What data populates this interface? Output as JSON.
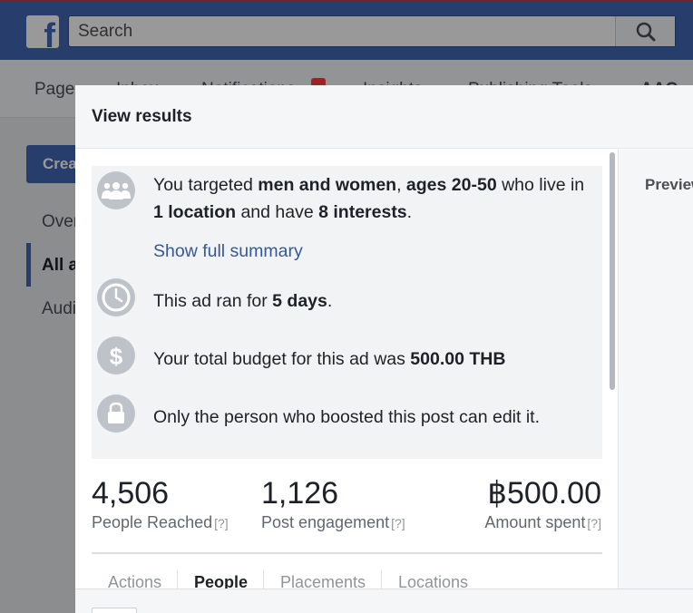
{
  "topbar": {
    "logo": "f",
    "search_placeholder": "Search",
    "search_icon": "search-icon"
  },
  "subnav": {
    "items": [
      "Page",
      "Inbox",
      "Notifications",
      "Insights",
      "Publishing Tools",
      "AAC"
    ]
  },
  "sidebar": {
    "create_label": "Create Ad",
    "links": [
      "Overview",
      "All ads",
      "Audiences"
    ]
  },
  "modal": {
    "title": "View results",
    "preview_label": "Preview",
    "summary": {
      "targeting_pre": "You targeted ",
      "gender": "men and women",
      "comma": ", ",
      "ages": "ages 20-50",
      "targeting_mid": " who live in ",
      "locations": "1 location",
      "targeting_and": " and have ",
      "interests": "8 interests",
      "targeting_end": ".",
      "show_full_summary": "Show full summary",
      "ran_pre": "This ad ran for ",
      "days": "5 days",
      "ran_end": ".",
      "budget_pre": "Your total budget for this ad was ",
      "budget": "500.00 THB",
      "edit_note": "Only the person who boosted this post can edit it."
    },
    "stats": [
      {
        "value": "4,506",
        "label": "People Reached",
        "help": "[?]"
      },
      {
        "value": "1,126",
        "label": "Post engagement",
        "help": "[?]"
      },
      {
        "value": "฿500.00",
        "label": "Amount spent",
        "help": "[?]"
      }
    ],
    "tabs": [
      "Actions",
      "People",
      "Placements",
      "Locations"
    ],
    "active_tab": "People"
  },
  "colors": {
    "brand": "#4267b2",
    "link": "#365899",
    "icon_bg": "#bec3c9"
  }
}
